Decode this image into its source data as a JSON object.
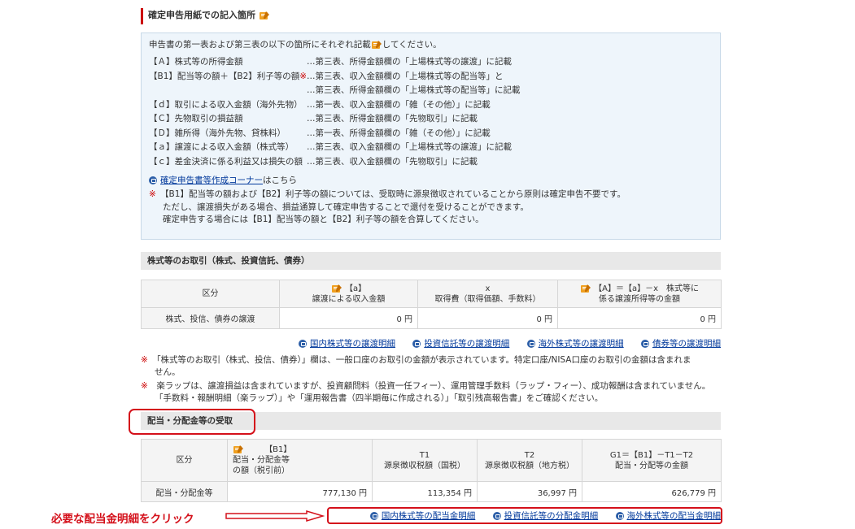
{
  "section_title": "確定申告用紙での記入箇所",
  "info": {
    "intro_pre": "申告書の第一表および第三表の以下の箇所にそれぞれ記載",
    "intro_post": "してください。",
    "rows": [
      {
        "k": "【Ａ】株式等の所得金額",
        "v": "…第三表、所得金額欄の「上場株式等の譲渡」に記載"
      },
      {
        "k": "【B1】配当等の額＋【B2】利子等の額",
        "mark": "※",
        "v": "…第三表、収入金額欄の「上場株式等の配当等」と"
      },
      {
        "k": "",
        "v": "…第三表、所得金額欄の「上場株式等の配当等」に記載"
      },
      {
        "k": "【ｄ】取引による収入金額（海外先物）",
        "v": "…第一表、収入金額欄の「雑（その他）」に記載"
      },
      {
        "k": "【Ｃ】先物取引の損益額",
        "v": "…第三表、所得金額欄の「先物取引」に記載"
      },
      {
        "k": "【Ｄ】雑所得（海外先物、貸株料）",
        "v": "…第一表、所得金額欄の「雑（その他）」に記載"
      },
      {
        "k": "【ａ】譲渡による収入金額（株式等）",
        "v": "…第三表、収入金額欄の「上場株式等の譲渡」に記載"
      },
      {
        "k": "【ｃ】差金決済に係る利益又は損失の額",
        "v": "…第三表、収入金額欄の「先物取引」に記載"
      }
    ],
    "link_text": "確定申告書等作成コーナー",
    "link_suffix": "はこちら",
    "note_mark": "※",
    "note_lines": [
      "【B1】配当等の額および【B2】利子等の額については、受取時に源泉徴収されていることから原則は確定申告不要です。",
      "ただし、譲渡損失がある場合、損益通算して確定申告することで還付を受けることができます。",
      "確定申告する場合には【B1】配当等の額と【B2】利子等の額を合算してください。"
    ]
  },
  "stocks": {
    "band_title": "株式等のお取引（株式、投資信託、債券）",
    "headers": {
      "kubun": "区分",
      "a_code": "【a】",
      "a_label": "譲渡による収入金額",
      "x_code": "x",
      "x_label": "取得費（取得価額、手数料）",
      "A_formula": "【A】＝【a】－x　株式等に",
      "A_label": "係る譲渡所得等の金額"
    },
    "row_label": "株式、投信、債券の譲渡",
    "values": [
      "0 円",
      "0 円",
      "0 円"
    ],
    "links": [
      "国内株式等の譲渡明細",
      "投資信託等の譲渡明細",
      "海外株式等の譲渡明細",
      "債券等の譲渡明細"
    ],
    "notes": [
      {
        "mark": "※",
        "text": "「株式等のお取引（株式、投信、債券）」欄は、一般口座のお取引の金額が表示されています。特定口座/NISA口座のお取引の金額は含まれま",
        "cont": "せん。"
      },
      {
        "mark": "※",
        "text": "楽ラップは、譲渡損益は含まれていますが、投資顧問料（投資一任フィー）、運用管理手数料（ラップ・フィー）、成功報酬は含まれていません。",
        "cont": "「手数料・報酬明細（楽ラップ）」や「運用報告書（四半期毎に作成される）」「取引残高報告書」をご確認ください。"
      }
    ]
  },
  "dividends": {
    "band_title": "配当・分配金等の受取",
    "headers": {
      "kubun": "区分",
      "b1_code": "【B1】",
      "b1_label1": "配当・分配金等",
      "b1_label2": "の額（税引前）",
      "t1_code": "T1",
      "t1_label": "源泉徴収税額（国税）",
      "t2_code": "T2",
      "t2_label": "源泉徴収税額（地方税）",
      "g1_formula": "G1＝【B1】－T1－T2",
      "g1_label": "配当・分配等の金額"
    },
    "row_label": "配当・分配金等",
    "values": [
      "777,130 円",
      "113,354 円",
      "36,997 円",
      "626,779 円"
    ],
    "links": [
      "国内株式等の配当金明細",
      "投資信託等の分配金明細",
      "海外株式等の配当金明細"
    ]
  },
  "annotation": {
    "callout": "必要な配当金明細をクリック"
  },
  "colors": {
    "accent_red": "#d4101a",
    "link_blue": "#00389b",
    "info_bg": "#eef5fb"
  }
}
